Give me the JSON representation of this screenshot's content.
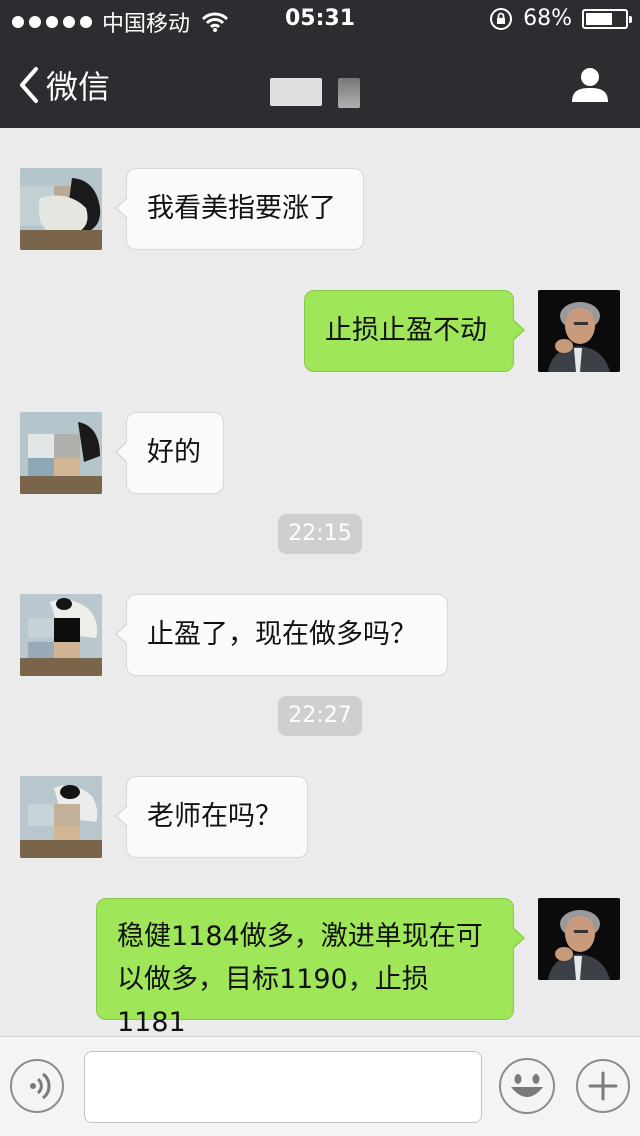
{
  "status_bar": {
    "carrier": "中国移动",
    "time": "05:31",
    "battery_percent": "68%",
    "battery_level": 0.68
  },
  "nav": {
    "back_label": "微信"
  },
  "messages": [
    {
      "side": "in",
      "text": "我看美指要涨了"
    },
    {
      "side": "out",
      "text": "止损止盈不动"
    },
    {
      "side": "in",
      "text": "好的"
    },
    {
      "side": "in",
      "text": "止盈了，现在做多吗？"
    },
    {
      "side": "in",
      "text": "老师在吗？"
    },
    {
      "side": "out",
      "text_line1": "稳健1184做多，激进单现在可",
      "text_line2": "以做多，目标1190，止损1181"
    }
  ],
  "timestamps": [
    "22:15",
    "22:27"
  ],
  "colors": {
    "bar": "#2d2d31",
    "chat_bg": "#ebebeb",
    "incoming_bubble": "#fafafa",
    "outgoing_bubble": "#9fe658"
  },
  "icons": {
    "back": "chevron-left-icon",
    "profile": "user-icon",
    "voice": "voice-icon",
    "emoji": "smiley-icon",
    "more": "plus-icon",
    "wifi": "wifi-icon",
    "lock": "rotation-lock-icon",
    "battery": "battery-icon"
  }
}
